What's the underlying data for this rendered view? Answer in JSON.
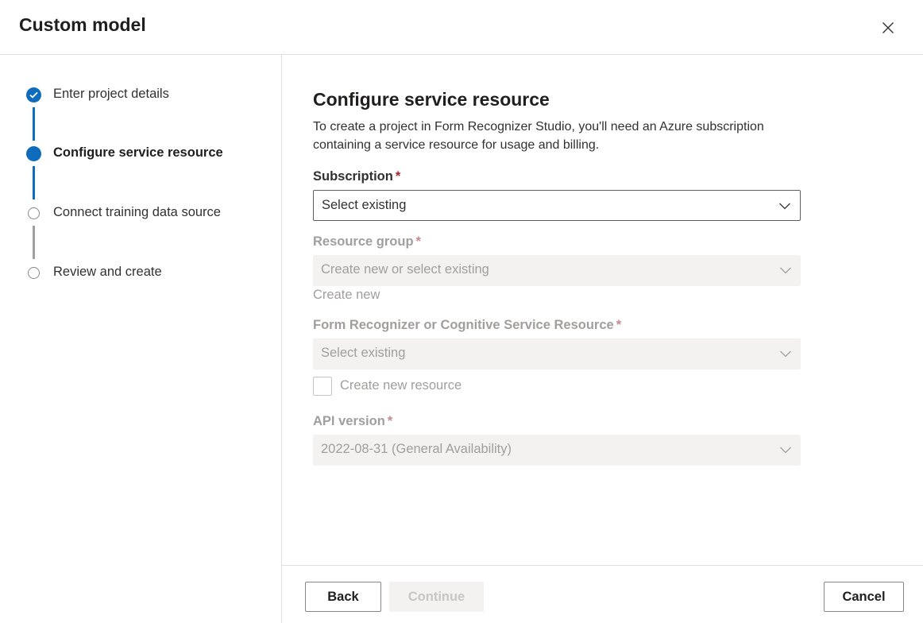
{
  "dialog": {
    "title": "Custom model",
    "close_icon": "close-icon"
  },
  "steps": [
    {
      "label": "Enter project details",
      "state": "completed",
      "icon": "checkmark-icon"
    },
    {
      "label": "Configure service resource",
      "state": "current"
    },
    {
      "label": "Connect training data source",
      "state": "pending"
    },
    {
      "label": "Review and create",
      "state": "pending"
    }
  ],
  "main": {
    "title": "Configure service resource",
    "description": "To create a project in Form Recognizer Studio, you'll need an Azure subscription containing a service resource for usage and billing.",
    "required_marker": "*",
    "subscription": {
      "label": "Subscription",
      "placeholder": "Select existing",
      "enabled": true
    },
    "resource_group": {
      "label": "Resource group",
      "placeholder": "Create new or select existing",
      "enabled": false,
      "create_new_link": "Create new"
    },
    "resource": {
      "label": "Form Recognizer or Cognitive Service Resource",
      "placeholder": "Select existing",
      "enabled": false,
      "checkbox_label": "Create new resource",
      "checkbox_checked": false
    },
    "api_version": {
      "label": "API version",
      "value": "2022-08-31 (General Availability)",
      "enabled": false
    }
  },
  "footer": {
    "back_label": "Back",
    "continue_label": "Continue",
    "continue_enabled": false,
    "cancel_label": "Cancel"
  },
  "colors": {
    "accent": "#0f6cbd",
    "required": "#a4262c",
    "disabled_text": "#a19f9d",
    "disabled_bg": "#f3f2f1"
  }
}
